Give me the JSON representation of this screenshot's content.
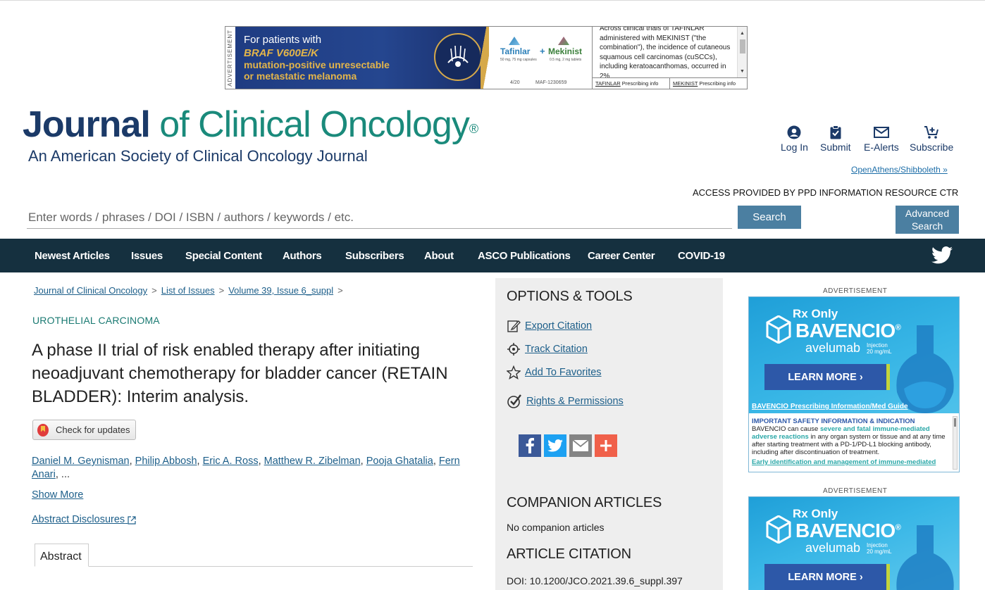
{
  "top_ad": {
    "vertical_label": "ADVERTISEMENT",
    "line1": "For patients with",
    "line2": "BRAF V600E/K",
    "line3": "mutation-positive unresectable",
    "line4": "or metastatic melanoma",
    "drug1": "Tafinlar",
    "drug1_sub": "50 mg, 75 mg capsules",
    "drug2": "Mekinist",
    "drug2_sub": "0.5 mg, 2 mg tablets",
    "plus": "+",
    "footer_date": "4/20",
    "footer_code": "MAF-1230659",
    "isi_text": "Across clinical trials of TAFINLAR administered with MEKINIST (\"the combination\"), the incidence of cutaneous squamous cell carcinomas (cuSCCs), including keratoacanthomas, occurred in 2%",
    "link1_name": "TAFINLAR",
    "link1_rest": " Prescribing info",
    "link2_name": "MEKINIST",
    "link2_rest": " Prescribing info"
  },
  "header": {
    "logo_journal": "Journal",
    "logo_rest": " of Clinical Oncology",
    "logo_reg": "®",
    "logo_subtitle": "An American Society of Clinical Oncology Journal",
    "utility": [
      {
        "label": "Log In",
        "icon": "user-circle-icon"
      },
      {
        "label": "Submit",
        "icon": "clipboard-check-icon"
      },
      {
        "label": "E-Alerts",
        "icon": "envelope-icon"
      },
      {
        "label": "Subscribe",
        "icon": "cart-plus-icon"
      }
    ],
    "openathens": "OpenAthens/Shibboleth »",
    "access": "ACCESS PROVIDED BY PPD INFORMATION RESOURCE CTR"
  },
  "search": {
    "placeholder": "Enter words / phrases / DOI / ISBN / authors / keywords / etc.",
    "value": "",
    "button": "Search",
    "advanced_line1": "Advanced",
    "advanced_line2": "Search"
  },
  "nav": {
    "items": [
      "Newest Articles",
      "Issues",
      "Special Content",
      "Authors",
      "Subscribers",
      "About",
      "ASCO Publications",
      "Career Center",
      "COVID-19"
    ],
    "social_icon": "twitter-icon"
  },
  "breadcrumb": [
    "Journal of Clinical Oncology",
    "List of Issues",
    "Volume 39, Issue 6_suppl"
  ],
  "article": {
    "section": "UROTHELIAL CARCINOMA",
    "title": "A phase II trial of risk enabled therapy after initiating neoadjuvant chemotherapy for bladder cancer (RETAIN BLADDER): Interim analysis.",
    "check_updates": "Check for updates",
    "authors": [
      "Daniel M. Geynisman",
      "Philip Abbosh",
      "Eric A. Ross",
      "Matthew R. Zibelman",
      "Pooja Ghatalia",
      "Fern Anari"
    ],
    "authors_more": "...",
    "show_more": "Show More",
    "disclosures": "Abstract Disclosures",
    "tab_abstract": "Abstract"
  },
  "tools": {
    "heading": "OPTIONS & TOOLS",
    "links": [
      {
        "label": "Export Citation",
        "icon": "edit-icon"
      },
      {
        "label": "Track Citation",
        "icon": "crosshair-icon"
      },
      {
        "label": "Add To Favorites",
        "icon": "star-icon"
      },
      {
        "label": "Rights & Permissions",
        "icon": "check-circle-icon"
      }
    ],
    "share": [
      {
        "name": "facebook-icon",
        "color": "#3b5998"
      },
      {
        "name": "twitter-icon",
        "color": "#1da1f2"
      },
      {
        "name": "email-icon",
        "color": "#848484"
      },
      {
        "name": "plus-icon",
        "color": "#f0604a"
      }
    ],
    "companion_heading": "COMPANION ARTICLES",
    "companion_text": "No companion articles",
    "citation_heading": "ARTICLE CITATION",
    "doi": "DOI: 10.1200/JCO.2021.39.6_suppl.397"
  },
  "right_ads": {
    "label": "ADVERTISEMENT",
    "rx": "Rx Only",
    "brand": "BAVENCIO",
    "reg": "®",
    "generic": "avelumab",
    "injection": "Injection",
    "dose": "20 mg/mL",
    "cta": "LEARN MORE ›",
    "pi_link": "BAVENCIO Prescribing Information/Med Guide",
    "isi_heading": "IMPORTANT SAFETY INFORMATION & INDICATION",
    "isi_p1": "BAVENCIO can cause ",
    "isi_hl": "severe and fatal immune-mediated adverse reactions",
    "isi_p2": " in any organ system or tissue and at any time after starting treatment with a PD-1/PD-L1 blocking antibody, including after discontinuation of treatment.",
    "isi_footer": "Early identification and management of immune-mediated"
  }
}
